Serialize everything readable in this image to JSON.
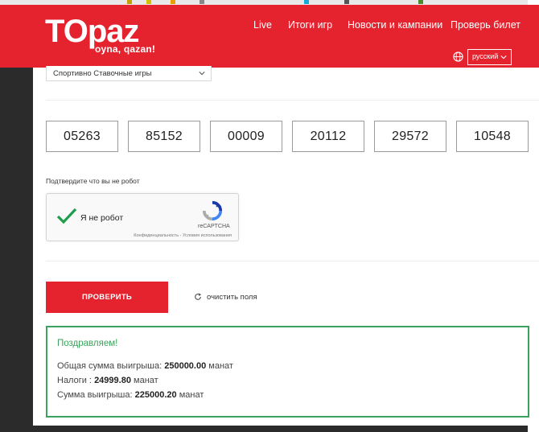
{
  "header": {
    "logo_main": "TOpaz",
    "logo_tagline": "oyna, qazan!",
    "nav": [
      "Live",
      "Итоги игр",
      "Новости и кампании",
      "Проверь билет"
    ],
    "language": "русский",
    "brand_color": "#e5232f"
  },
  "form": {
    "game_select_value": "Спортивно Ставочные игры",
    "ticket_numbers": [
      "05263",
      "85152",
      "00009",
      "20112",
      "29572",
      "10548"
    ],
    "robot_prompt": "Подтвердите что вы не робот",
    "captcha": {
      "checkbox_label": "Я не робот",
      "brand": "reCAPTCHA",
      "links": "Конфиденциальность - Условия использования",
      "checked": true
    },
    "check_button": "ПРОВЕРИТЬ",
    "clear_link": "очистить поля"
  },
  "result": {
    "title": "Поздравляем!",
    "total_label": "Общая сумма выигрыша:",
    "total_value": "250000.00",
    "tax_label": "Налоги :",
    "tax_value": "24999.80",
    "net_label": "Сумма выигрыша:",
    "net_value": "225000.20",
    "currency": "манат",
    "accent_color": "#3aa35c"
  }
}
